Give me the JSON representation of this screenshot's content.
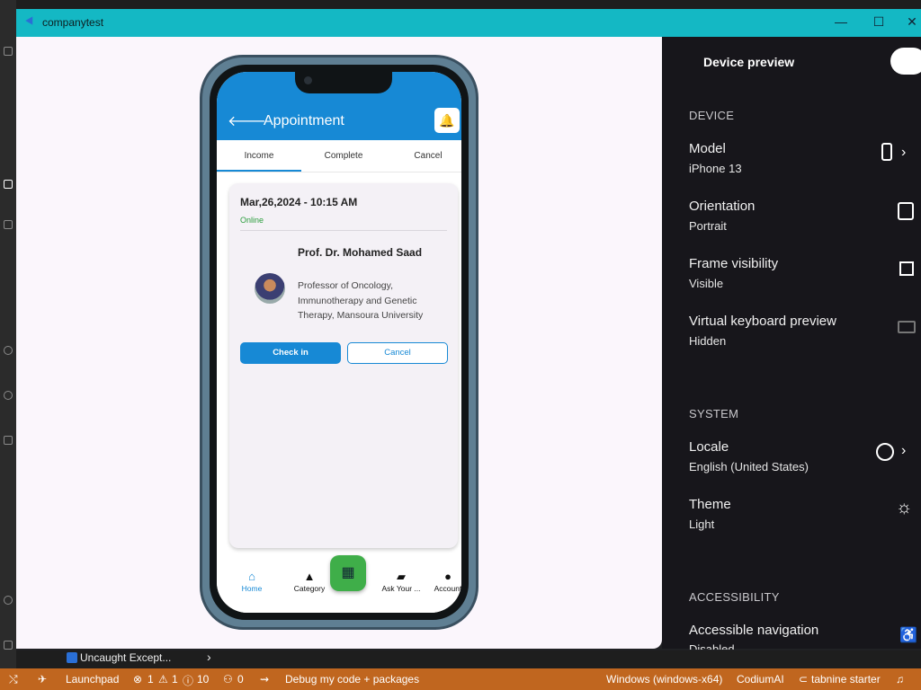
{
  "window": {
    "title": "companytest",
    "accent": "#14b8c4"
  },
  "app": {
    "header_title": "Appointment",
    "tabs": [
      "Income",
      "Complete",
      "Cancel"
    ],
    "card": {
      "date": "Mar,26,2024 - 10:15 AM",
      "status": "Online",
      "doctor_name": "Prof. Dr. Mohamed Saad",
      "doctor_title": "Professor of Oncology, Immunotherapy and Genetic Therapy, Mansoura University",
      "checkin_label": "Check in",
      "cancel_label": "Cancel"
    },
    "nav": {
      "home": "Home",
      "category": "Category",
      "ask": "Ask Your ...",
      "account": "Account"
    },
    "primary_color": "#1789d5",
    "fab_color": "#3fae49"
  },
  "panel": {
    "heading": "Device preview",
    "device_section": "DEVICE",
    "model_title": "Model",
    "model_value": "iPhone 13",
    "orientation_title": "Orientation",
    "orientation_value": "Portrait",
    "frame_title": "Frame visibility",
    "frame_value": "Visible",
    "keyboard_title": "Virtual keyboard preview",
    "keyboard_value": "Hidden",
    "system_section": "SYSTEM",
    "locale_title": "Locale",
    "locale_value": "English (United States)",
    "theme_title": "Theme",
    "theme_value": "Light",
    "accessibility_section": "ACCESSIBILITY",
    "access_nav_title": "Accessible navigation",
    "access_nav_value": "Disabled"
  },
  "problems": {
    "label": "Uncaught Except..."
  },
  "statusbar": {
    "launchpad": "Launchpad",
    "errors": "1",
    "warnings": "1",
    "info": "10",
    "ports": "0",
    "debug": "Debug my code + packages",
    "platform": "Windows (windows-x64)",
    "codium": "CodiumAI",
    "tabnine": "tabnine starter",
    "color": "#c0661f"
  }
}
